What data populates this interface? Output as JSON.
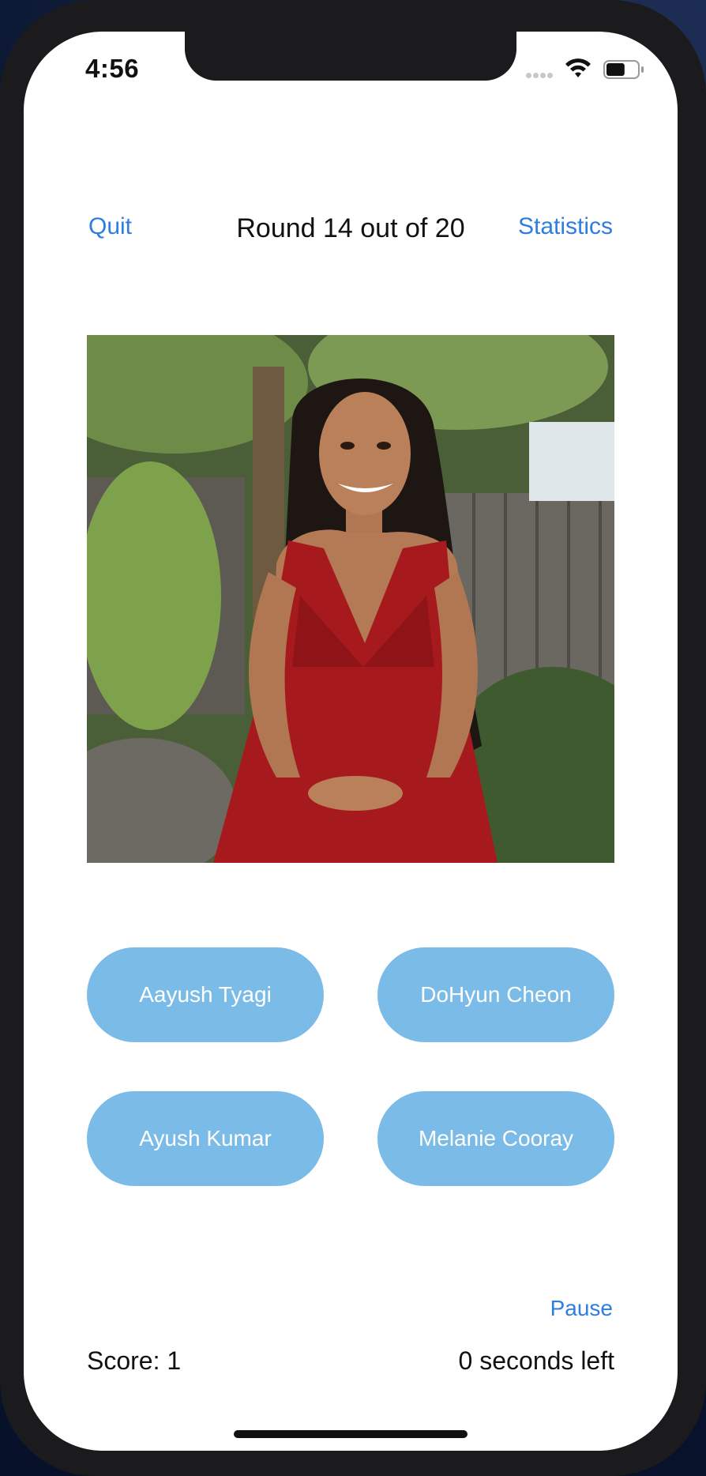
{
  "status_bar": {
    "time": "4:56",
    "battery_level": 0.6,
    "icons": [
      "cellular-icon",
      "wifi-icon",
      "battery-icon"
    ]
  },
  "nav": {
    "quit_label": "Quit",
    "title": "Round 14 out of 20",
    "statistics_label": "Statistics"
  },
  "photo": {
    "subject": "portrait-photo"
  },
  "choices": [
    {
      "label": "Aayush Tyagi"
    },
    {
      "label": "DoHyun Cheon"
    },
    {
      "label": "Ayush Kumar"
    },
    {
      "label": "Melanie Cooray"
    }
  ],
  "footer": {
    "pause_label": "Pause",
    "score_text": "Score: 1",
    "timer_text": "0 seconds left"
  },
  "colors": {
    "accent": "#2f7de1",
    "button_fill": "#7bbbe8",
    "button_text": "#ffffff"
  }
}
